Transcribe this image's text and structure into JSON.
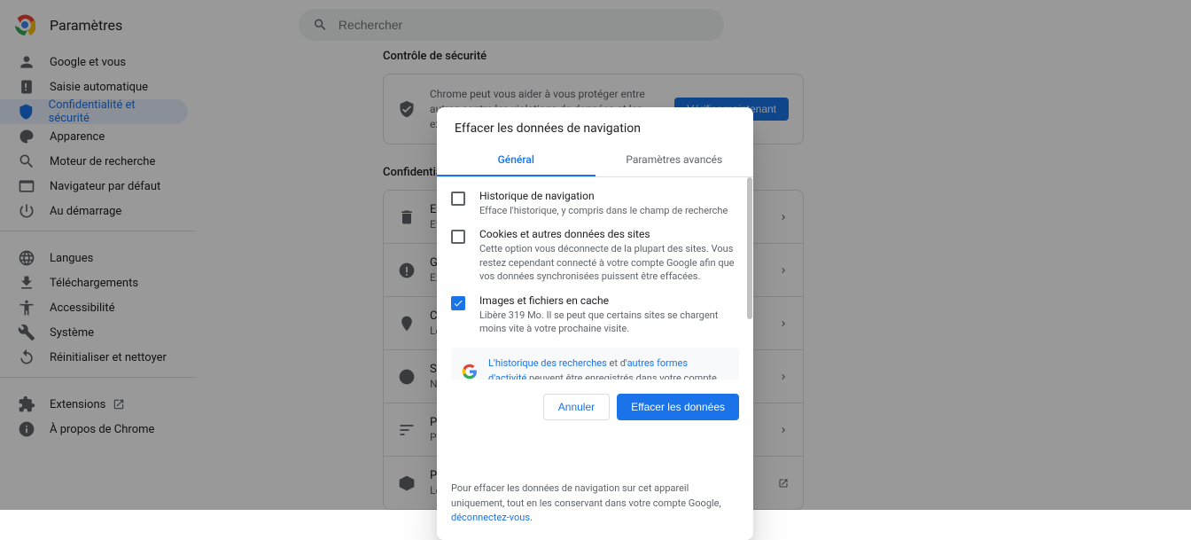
{
  "header": {
    "title": "Paramètres",
    "search_placeholder": "Rechercher"
  },
  "sidebar": {
    "groups": [
      [
        {
          "icon": "person",
          "label": "Google et vous"
        },
        {
          "icon": "autofill",
          "label": "Saisie automatique"
        },
        {
          "icon": "shield",
          "label": "Confidentialité et sécurité",
          "active": true
        },
        {
          "icon": "palette",
          "label": "Apparence"
        },
        {
          "icon": "search",
          "label": "Moteur de recherche"
        },
        {
          "icon": "browser",
          "label": "Navigateur par défaut"
        },
        {
          "icon": "power",
          "label": "Au démarrage"
        }
      ],
      [
        {
          "icon": "globe",
          "label": "Langues"
        },
        {
          "icon": "download",
          "label": "Téléchargements"
        },
        {
          "icon": "accessibility",
          "label": "Accessibilité"
        },
        {
          "icon": "wrench",
          "label": "Système"
        },
        {
          "icon": "reset",
          "label": "Réinitialiser et nettoyer"
        }
      ],
      [
        {
          "icon": "extension",
          "label": "Extensions",
          "external": true
        },
        {
          "icon": "info",
          "label": "À propos de Chrome"
        }
      ]
    ]
  },
  "main": {
    "security_check_title": "Contrôle de sécurité",
    "security_check_text": "Chrome peut vous aider à vous protéger entre autres contre les violations de données et les extensions malveillantes",
    "verify_button": "Vérifier maintenant",
    "privacy_section_title": "Confidentialité",
    "rows": [
      {
        "title": "Effa",
        "desc": "Effa"
      },
      {
        "title": "Guid",
        "desc": "Exam"
      },
      {
        "title": "Coo",
        "desc": "Les"
      },
      {
        "title": "Séc",
        "desc": "Nav"
      },
      {
        "title": "Para",
        "desc": "Perm\nphot"
      },
      {
        "title": "Priva",
        "desc": "Les"
      }
    ]
  },
  "modal": {
    "title": "Effacer les données de navigation",
    "tabs": {
      "general": "Général",
      "advanced": "Paramètres avancés"
    },
    "items": [
      {
        "checked": false,
        "title": "Historique de navigation",
        "desc": "Efface l'historique, y compris dans le champ de recherche"
      },
      {
        "checked": false,
        "title": "Cookies et autres données des sites",
        "desc": "Cette option vous déconnecte de la plupart des sites. Vous restez cependant connecté à votre compte Google afin que vos données synchronisées puissent être effacées."
      },
      {
        "checked": true,
        "title": "Images et fichiers en cache",
        "desc": "Libère 319 Mo. Il se peut que certains sites se chargent moins vite à votre prochaine visite."
      }
    ],
    "info": {
      "link1": "L'historique des recherches",
      "mid1": " et d'",
      "link2": "autres formes d'activité",
      "tail": " peuvent être enregistrés dans votre compte Google lorsque vous êtes connecté. Vous pouvez les supprimer à tout moment."
    },
    "cancel": "Annuler",
    "confirm": "Effacer les données",
    "footer": {
      "text": "Pour effacer les données de navigation sur cet appareil uniquement, tout en les conservant dans votre compte Google, ",
      "link": "déconnectez-vous",
      "end": "."
    }
  }
}
